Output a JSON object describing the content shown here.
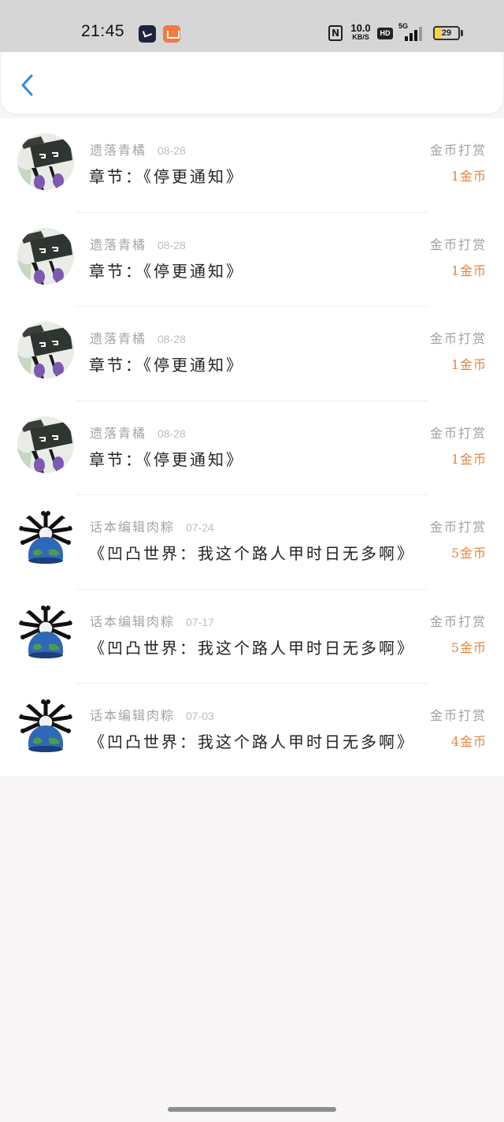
{
  "status_bar": {
    "time": "21:45",
    "network_speed": "10.0",
    "network_unit": "KB/S",
    "hd": "HD",
    "network_type": "5G",
    "battery_level": "29",
    "battery_fraction": 0.29
  },
  "header": {
    "back_icon": "chevron-left-icon",
    "accent_color": "#2f8be6"
  },
  "colors": {
    "amount": "#e8843a",
    "muted": "#a4a4a4"
  },
  "records": [
    {
      "name": "遗落青橘",
      "date": "08-28",
      "chapter": "章节：《停更通知》",
      "type": "金币打赏",
      "amount": "1金币",
      "avatar": "anime-avatar"
    },
    {
      "name": "遗落青橘",
      "date": "08-28",
      "chapter": "章节：《停更通知》",
      "type": "金币打赏",
      "amount": "1金币",
      "avatar": "anime-avatar"
    },
    {
      "name": "遗落青橘",
      "date": "08-28",
      "chapter": "章节：《停更通知》",
      "type": "金币打赏",
      "amount": "1金币",
      "avatar": "anime-avatar"
    },
    {
      "name": "遗落青橘",
      "date": "08-28",
      "chapter": "章节：《停更通知》",
      "type": "金币打赏",
      "amount": "1金币",
      "avatar": "anime-avatar"
    },
    {
      "name": "话本编辑肉粽",
      "date": "07-24",
      "chapter": "《凹凸世界：我这个路人甲时日无多啊》",
      "type": "金币打赏",
      "amount": "5金币",
      "avatar": "globe-avatar"
    },
    {
      "name": "话本编辑肉粽",
      "date": "07-17",
      "chapter": "《凹凸世界：我这个路人甲时日无多啊》",
      "type": "金币打赏",
      "amount": "5金币",
      "avatar": "globe-avatar"
    },
    {
      "name": "话本编辑肉粽",
      "date": "07-03",
      "chapter": "《凹凸世界：我这个路人甲时日无多啊》",
      "type": "金币打赏",
      "amount": "4金币",
      "avatar": "globe-avatar"
    }
  ]
}
